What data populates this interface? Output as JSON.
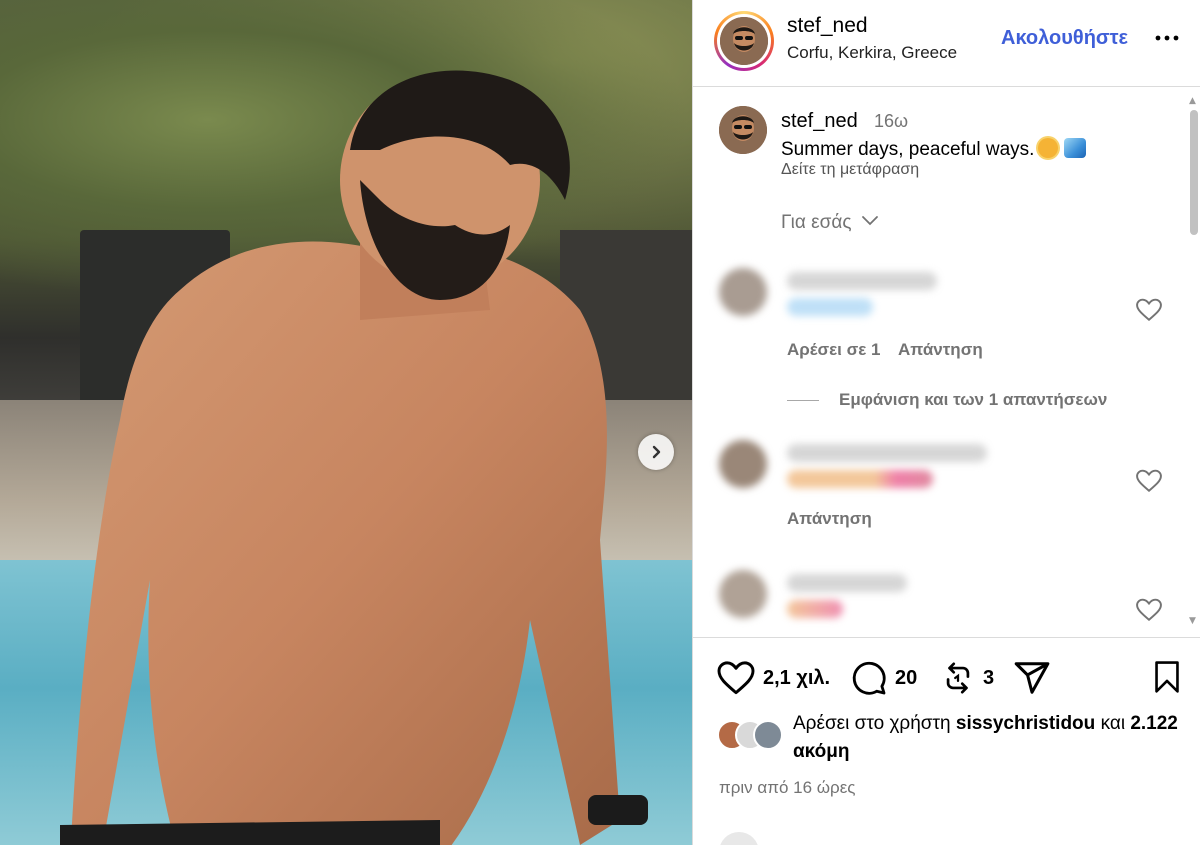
{
  "post": {
    "username": "stef_ned",
    "location": "Corfu, Kerkira, Greece",
    "follow_label": "Ακολουθήστε",
    "more_label": "•••"
  },
  "caption": {
    "username": "stef_ned",
    "time_ago": "16ω",
    "text": "Summer days, peaceful ways.",
    "emojis": [
      "sun",
      "water-wave"
    ],
    "translate_label": "Δείτε τη μετάφραση"
  },
  "comments": {
    "filter_label": "Για εσάς",
    "items": [
      {
        "likes_label": "Αρέσει σε 1",
        "reply_label": "Απάντηση"
      },
      {
        "reply_label": "Απάντηση"
      },
      {}
    ],
    "view_replies_label": "Εμφάνιση και των 1 απαντήσεων"
  },
  "actions": {
    "likes_count": "2,1 χιλ.",
    "comments_count": "20",
    "reposts_count": "3"
  },
  "liked_by": {
    "prefix": "Αρέσει στο χρήστη",
    "user": "sissychristidou",
    "connector": "και",
    "others": "2.122 ακόμη"
  },
  "time_label": "πριν από 16 ώρες",
  "colors": {
    "accent": "#3f5fd8",
    "muted": "#737373",
    "border": "#dbdbdb"
  }
}
